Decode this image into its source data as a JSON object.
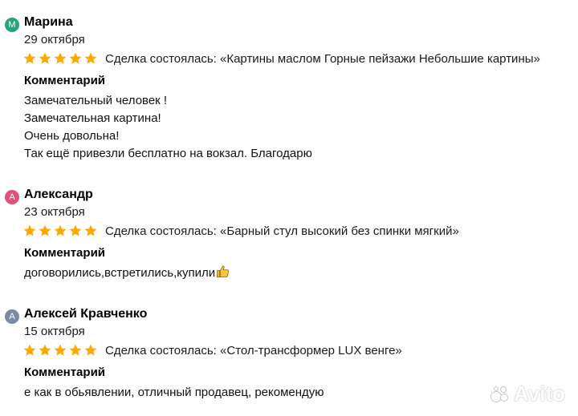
{
  "reviews": [
    {
      "avatar_letter": "М",
      "avatar_color": "#27a37a",
      "name": "Марина",
      "date": "29 октября",
      "rating": 5,
      "deal": "Сделка состоялась: «Картины маслом Горные пейзажи Небольшие картины»",
      "comment_label": "Комментарий",
      "comment_lines": [
        "Замечательный человек !",
        "Замечательная картина!",
        "Очень довольна!",
        "Так ещё привезли бесплатно на вокзал. Благодарю"
      ]
    },
    {
      "avatar_letter": "А",
      "avatar_color": "#e0507a",
      "name": "Александр",
      "date": "23 октября",
      "rating": 5,
      "deal": "Сделка состоялась: «Барный стул высокий без спинки мягкий»",
      "comment_label": "Комментарий",
      "comment_lines": [
        "договорились,встретились,купили"
      ],
      "comment_emoji": "thumbs-up-icon"
    },
    {
      "avatar_letter": "А",
      "avatar_color": "#7b8aa3",
      "name": "Алексей Кравченко",
      "date": "15 октября",
      "rating": 5,
      "deal": "Сделка состоялась: «Стол-трансформер LUX венге»",
      "comment_label": "Комментарий",
      "comment_lines": [
        "е как в обьявлении, отличный продавец, рекомендую"
      ]
    }
  ],
  "star_color": "#ffa800",
  "watermark": {
    "text": "Avito",
    "icon": "avito-logo-icon"
  }
}
